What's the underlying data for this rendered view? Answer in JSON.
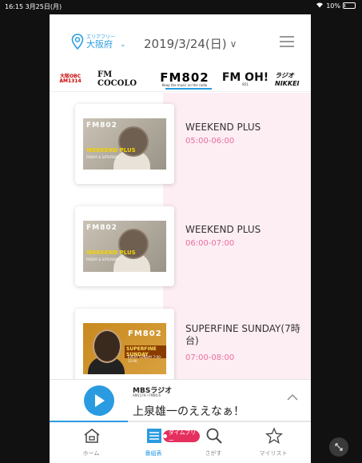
{
  "status": {
    "time": "16:15  3月25日(月)",
    "battery": "10%",
    "battery_level": 0.1
  },
  "header": {
    "area_label": "エリアフリー",
    "area_name": "大阪府",
    "date": "2019/3/24(日)"
  },
  "stations": [
    {
      "name": "大阪OBC",
      "sub": "AM1314"
    },
    {
      "name": "FM COCOLO"
    },
    {
      "name": "FM802",
      "tag": "Keep the music on the radio",
      "selected": true
    },
    {
      "name": "FM OH!",
      "tag": "851"
    },
    {
      "name": "ラジオNIKKEI"
    }
  ],
  "programs": [
    {
      "title": "WEEKEND PLUS",
      "time": "05:00-06:00",
      "brand": "FM802",
      "image_text": "WEEKEND PLUS",
      "image_sub": "FRIDAY & SATURDAY"
    },
    {
      "title": "WEEKEND PLUS",
      "time": "06:00-07:00",
      "brand": "FM802",
      "image_text": "WEEKEND PLUS",
      "image_sub": "FRIDAY & SATURDAY"
    },
    {
      "title": "SUPERFINE SUNDAY(7時台)",
      "time": "07:00-08:00",
      "brand": "FM802",
      "image_text": "SUPERFINE SUNDAY",
      "image_sub": "EVERY SUNDAY 7:00-12:00"
    }
  ],
  "player": {
    "station_logo": "MBSラジオ",
    "station_sub": "AM1179 / FM90.6",
    "now_playing": "上泉雄一のええなぁ！",
    "progress": 0.3
  },
  "tabs": [
    {
      "label": "ホーム",
      "icon": "home-icon"
    },
    {
      "label": "番組表",
      "icon": "program-guide-icon",
      "active": true
    },
    {
      "label": "さがす",
      "icon": "search-icon"
    },
    {
      "label": "マイリスト",
      "icon": "star-icon"
    }
  ],
  "timefree_badge": "タイムフリー",
  "colors": {
    "accent": "#2a9be0",
    "time_pink": "#e86ea0",
    "timeline_bg": "#fdeef3",
    "timefree_red": "#e5305e"
  }
}
